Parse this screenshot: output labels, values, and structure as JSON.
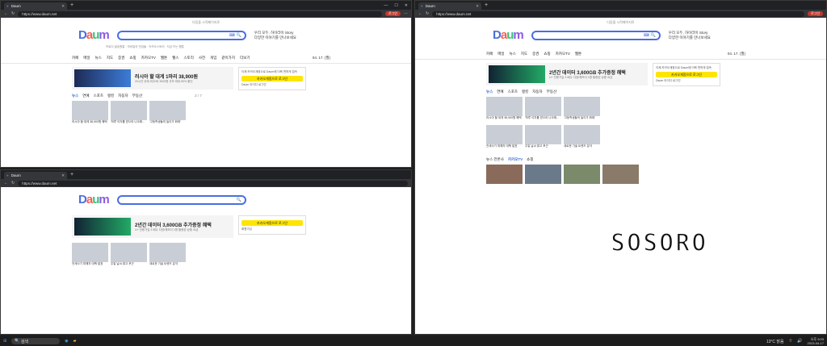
{
  "browser": {
    "tab_title": "Daum",
    "url": "https://www.daum.net",
    "login_label": "로그인",
    "new_tab": "+"
  },
  "page": {
    "top_hint": "다음을 시작페이지로",
    "logo_letters": [
      "D",
      "a",
      "u",
      "m"
    ],
    "story_line1": "우리 모두, 하이라이 Story",
    "story_line2": "다양한 이야기를 만나보세요",
    "quick_links": "프로다 발송원통 · 모바일의 맛집들 · 카카오스토리  · 지금 뜨는 웹툰",
    "gnb": [
      "카페",
      "메일",
      "뉴스",
      "지도",
      "증권",
      "쇼핑",
      "카카오TV",
      "웹툰",
      "웰스",
      "스토리",
      "사전",
      "게임",
      "같이가치",
      "더보기"
    ],
    "date": "04. 17. (월)",
    "weather": "강원도 16°C",
    "banner_left_title": "러시아 할 대게 1마리 38,900원",
    "banner_left_sub": "20시간 뒤에 비주/바 3000원 규모 최대 80% 할인",
    "banner_right_title": "2년간 데이터 3,600GB 추가증정 혜택",
    "banner_right_sub": "U+ 전용가입 3 배수 다양/체보다 1원 할증된 상품 요금",
    "login_prompt": "이제 카카오계정으로 Daum에 더욱 편하게 접속",
    "kakao_login": "카카오계정으로 로그인",
    "daum_id_login": "Daum 아이디 로그인",
    "join": "회원가입",
    "news_tabs": [
      "뉴스",
      "연예",
      "스포츠",
      "랭킹",
      "자동차",
      "부동산"
    ],
    "page_indicator": "2 / 7",
    "shopping": "쇼핑",
    "kakao_tv": "카카오TV",
    "news_stand": "뉴스 언론사",
    "captions": [
      "러시아 할 대게 38,900원 혜택",
      "'하루 이자를 받으러 나오래...",
      "'고등학생들의 놀이가 화제'",
      "전세사기 피해자 대책 발표",
      "주말 날씨 맑고 포근",
      "새로운 기술 트렌드 분석"
    ]
  },
  "taskbar": {
    "search": "검색",
    "weather": "13°C 맑음",
    "time": "오후 9:03",
    "date": "2023-04-17"
  },
  "watermark": "SOSORO"
}
